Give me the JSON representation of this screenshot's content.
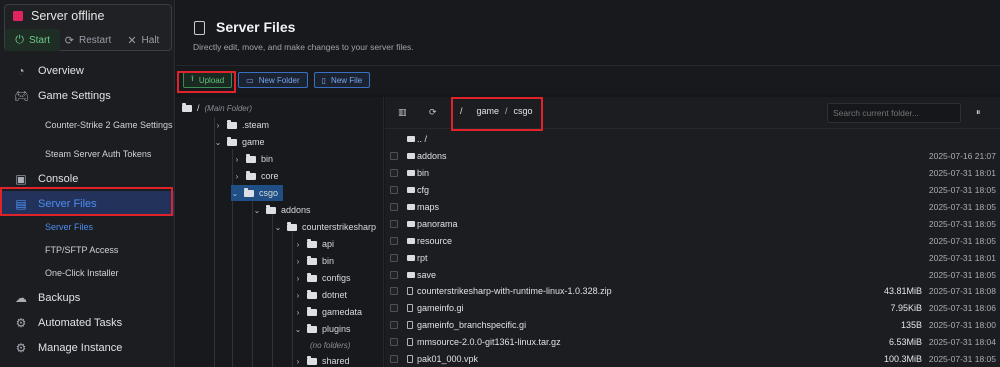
{
  "server_status": {
    "label": "Server offline",
    "color": "#e0245e",
    "actions": [
      {
        "label": "Start",
        "icon": "power-icon"
      },
      {
        "label": "Restart",
        "icon": "restart-icon"
      },
      {
        "label": "Halt",
        "icon": "close-icon"
      }
    ]
  },
  "sidebar": {
    "overview": "Overview",
    "game_settings": "Game Settings",
    "game_settings_sub": [
      "Counter-Strike 2 Game Settings",
      "Steam Server Auth Tokens"
    ],
    "console": "Console",
    "server_files": "Server Files",
    "server_files_sub": [
      "Server Files",
      "FTP/SFTP Access",
      "One-Click Installer"
    ],
    "backups": "Backups",
    "automated_tasks": "Automated Tasks",
    "manage_instance": "Manage Instance"
  },
  "header": {
    "title": "Server Files",
    "subtitle": "Directly edit, move, and make changes to your server files."
  },
  "toolbar": {
    "upload": "Upload",
    "new_folder": "New Folder",
    "new_file": "New File"
  },
  "tree": {
    "root": "/",
    "root_note": "(Main Folder)",
    "steam": ".steam",
    "game": "game",
    "bin": "bin",
    "core": "core",
    "csgo": "csgo",
    "addons": "addons",
    "counterstrikesharp": "counterstrikesharp",
    "api": "api",
    "bin2": "bin",
    "configs": "configs",
    "dotnet": "dotnet",
    "gamedata": "gamedata",
    "plugins": "plugins",
    "no_folders": "(no folders)",
    "shared": "shared"
  },
  "pane": {
    "breadcrumb": [
      "/",
      "game",
      "/",
      "csgo"
    ],
    "search_placeholder": "Search current folder...",
    "up": ".. /",
    "rows": [
      {
        "name": "addons",
        "type": "folder",
        "size": "",
        "date": "2025-07-16 21:07"
      },
      {
        "name": "bin",
        "type": "folder",
        "size": "",
        "date": "2025-07-31 18:01"
      },
      {
        "name": "cfg",
        "type": "folder",
        "size": "",
        "date": "2025-07-31 18:05"
      },
      {
        "name": "maps",
        "type": "folder",
        "size": "",
        "date": "2025-07-31 18:05"
      },
      {
        "name": "panorama",
        "type": "folder",
        "size": "",
        "date": "2025-07-31 18:05"
      },
      {
        "name": "resource",
        "type": "folder",
        "size": "",
        "date": "2025-07-31 18:05"
      },
      {
        "name": "rpt",
        "type": "folder",
        "size": "",
        "date": "2025-07-31 18:01"
      },
      {
        "name": "save",
        "type": "folder",
        "size": "",
        "date": "2025-07-31 18:05"
      },
      {
        "name": "counterstrikesharp-with-runtime-linux-1.0.328.zip",
        "type": "file",
        "size": "43.81MiB",
        "date": "2025-07-31 18:08"
      },
      {
        "name": "gameinfo.gi",
        "type": "file",
        "size": "7.95KiB",
        "date": "2025-07-31 18:06"
      },
      {
        "name": "gameinfo_branchspecific.gi",
        "type": "file",
        "size": "135B",
        "date": "2025-07-31 18:00"
      },
      {
        "name": "mmsource-2.0.0-git1361-linux.tar.gz",
        "type": "file",
        "size": "6.53MiB",
        "date": "2025-07-31 18:04"
      },
      {
        "name": "pak01_000.vpk",
        "type": "file",
        "size": "100.3MiB",
        "date": "2025-07-31 18:05"
      }
    ]
  },
  "colors": {
    "accent": "#4d8df0",
    "highlight": "#e0222b",
    "upload_green": "#62c47f"
  }
}
